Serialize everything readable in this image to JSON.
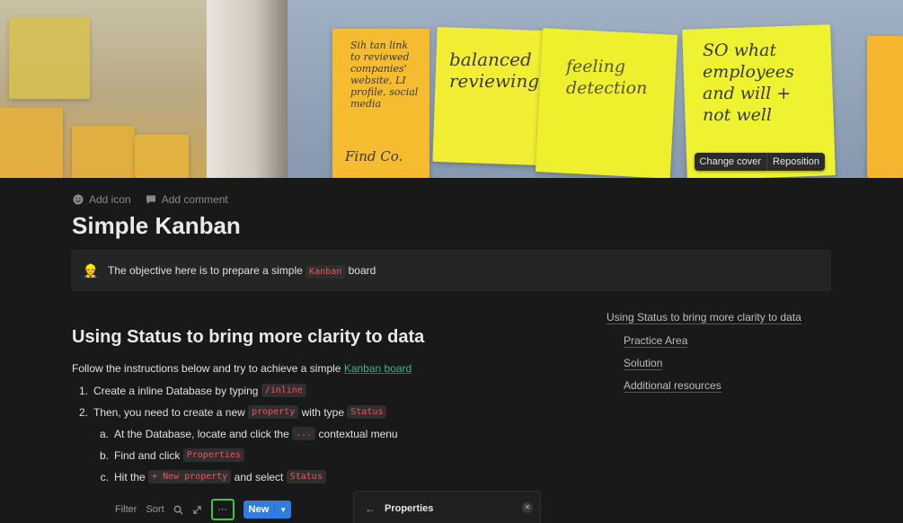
{
  "cover": {
    "notes": [
      "Sih tan link\nto reviewed\ncompanies'\nwebsite, LI\nprofile, social\nmedia",
      "Find Co.",
      "balanced\nreviewing",
      "feeling\ndetection",
      "SO what\nemployees\nand will +\nnot well"
    ],
    "change_cover": "Change cover",
    "reposition": "Reposition"
  },
  "page_actions": {
    "add_icon": "Add icon",
    "add_comment": "Add comment"
  },
  "title": "Simple Kanban",
  "callout": {
    "emoji": "👷",
    "text_before": "The objective here is to prepare a simple",
    "code": "Kanban",
    "text_after": "board"
  },
  "section": {
    "heading": "Using Status to bring more clarity to data",
    "intro": "Follow the instructions below and try to achieve a simple",
    "intro_link": "Kanban board",
    "steps": [
      {
        "marker": "1.",
        "text": "Create a inline Database by typing",
        "code": "/inline"
      },
      {
        "marker": "2.",
        "text": "Then, you need to create a new",
        "code": "property",
        "text2": "with type",
        "code2": "Status"
      }
    ],
    "substeps": [
      {
        "marker": "a.",
        "text": "At the Database, locate and click the",
        "code": "...",
        "text2": "contextual menu"
      },
      {
        "marker": "b.",
        "text": "Find and click",
        "code": "Properties"
      },
      {
        "marker": "c.",
        "text": "Hit the",
        "code": "+ New property",
        "text2": "and select",
        "code2": "Status"
      }
    ]
  },
  "toc": [
    "Using Status to bring more clarity to data",
    "Practice Area",
    "Solution",
    "Additional resources"
  ],
  "embed": {
    "filter": "Filter",
    "sort": "Sort",
    "dots": "···",
    "new": "New",
    "props_title": "Properties"
  }
}
